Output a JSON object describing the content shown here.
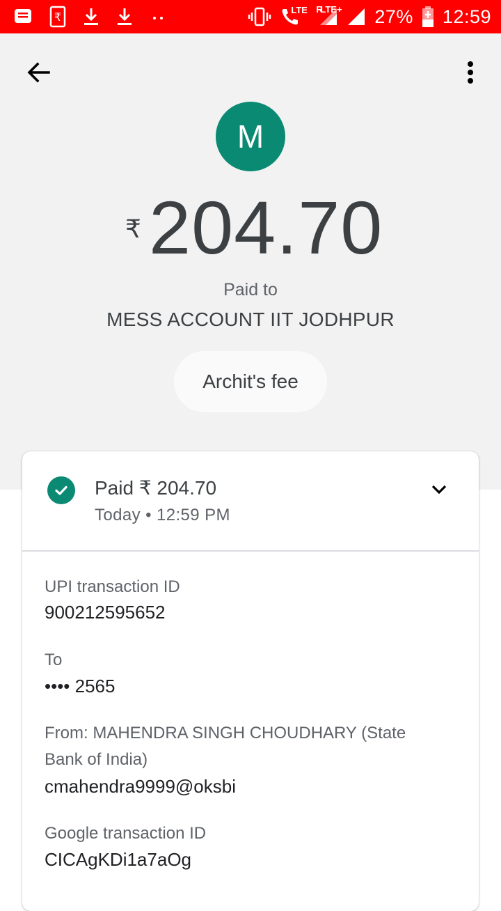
{
  "status_bar": {
    "battery": "27%",
    "time": "12:59",
    "network_lte": "LTE",
    "network_r": "R",
    "network_lte_plus": "LTE+"
  },
  "header": {
    "back_icon": "arrow-back-icon",
    "more_icon": "more-vert-icon"
  },
  "payee": {
    "avatar_letter": "M",
    "avatar_color": "#0b8a73",
    "currency_symbol": "₹",
    "amount": "204.70",
    "paid_to_label": "Paid to",
    "name": "MESS ACCOUNT IIT JODHPUR",
    "note": "Archit's fee"
  },
  "summary": {
    "status": "Paid ₹ 204.70",
    "datetime": "Today • 12:59 PM",
    "status_icon": "check-circle-icon",
    "status_color": "#0b8a73",
    "expand_icon": "chevron-down-icon"
  },
  "details": {
    "upi_label": "UPI transaction ID",
    "upi_value": "900212595652",
    "to_label": "To",
    "to_value": "•••• 2565",
    "from_label_line1": "From: MAHENDRA SINGH  CHOUDHARY (State",
    "from_label_line2": "Bank of India)",
    "from_value": "cmahendra9999@oksbi",
    "google_label": "Google transaction ID",
    "google_value": "CICAgKDi1a7aOg"
  }
}
